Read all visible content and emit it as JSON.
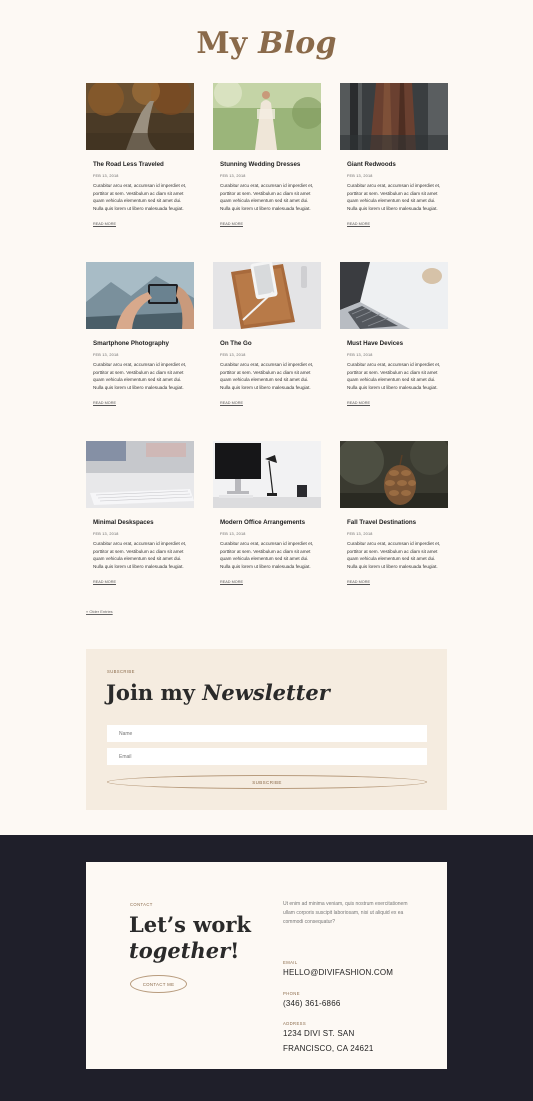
{
  "page": {
    "title_plain": "My",
    "title_italic": "Blog"
  },
  "posts": [
    {
      "title": "The Road Less Traveled",
      "date": "FEB 13, 2018",
      "excerpt": "Curabitur arcu erat, accumsan id imperdiet et, porttitor at sem. Vestibulum ac diam sit amet quam vehicula elementum sed sit amet dui. Nulla quis lorem ut libero malesuada feugiat.",
      "read_more": "READ MORE",
      "image": "forest-road"
    },
    {
      "title": "Stunning Wedding Dresses",
      "date": "FEB 13, 2018",
      "excerpt": "Curabitur arcu erat, accumsan id imperdiet et, porttitor at sem. Vestibulum ac diam sit amet quam vehicula elementum sed sit amet dui. Nulla quis lorem ut libero malesuada feugiat.",
      "read_more": "READ MORE",
      "image": "bride-field"
    },
    {
      "title": "Giant Redwoods",
      "date": "FEB 13, 2018",
      "excerpt": "Curabitur arcu erat, accumsan id imperdiet et, porttitor at sem. Vestibulum ac diam sit amet quam vehicula elementum sed sit amet dui. Nulla quis lorem ut libero malesuada feugiat.",
      "read_more": "READ MORE",
      "image": "redwood-trunk"
    },
    {
      "title": "Smartphone Photography",
      "date": "FEB 13, 2018",
      "excerpt": "Curabitur arcu erat, accumsan id imperdiet et, porttitor at sem. Vestibulum ac diam sit amet quam vehicula elementum sed sit amet dui. Nulla quis lorem ut libero malesuada feugiat.",
      "read_more": "READ MORE",
      "image": "phone-mountains"
    },
    {
      "title": "On The Go",
      "date": "FEB 13, 2018",
      "excerpt": "Curabitur arcu erat, accumsan id imperdiet et, porttitor at sem. Vestibulum ac diam sit amet quam vehicula elementum sed sit amet dui. Nulla quis lorem ut libero malesuada feugiat.",
      "read_more": "READ MORE",
      "image": "phone-leather-case"
    },
    {
      "title": "Must Have Devices",
      "date": "FEB 13, 2018",
      "excerpt": "Curabitur arcu erat, accumsan id imperdiet et, porttitor at sem. Vestibulum ac diam sit amet quam vehicula elementum sed sit amet dui. Nulla quis lorem ut libero malesuada feugiat.",
      "read_more": "READ MORE",
      "image": "laptop-keyboard"
    },
    {
      "title": "Minimal Deskspaces",
      "date": "FEB 13, 2018",
      "excerpt": "Curabitur arcu erat, accumsan id imperdiet et, porttitor at sem. Vestibulum ac diam sit amet quam vehicula elementum sed sit amet dui. Nulla quis lorem ut libero malesuada feugiat.",
      "read_more": "READ MORE",
      "image": "white-keyboard"
    },
    {
      "title": "Modern Office Arrangements",
      "date": "FEB 13, 2018",
      "excerpt": "Curabitur arcu erat, accumsan id imperdiet et, porttitor at sem. Vestibulum ac diam sit amet quam vehicula elementum sed sit amet dui. Nulla quis lorem ut libero malesuada feugiat.",
      "read_more": "READ MORE",
      "image": "desk-monitor-lamp"
    },
    {
      "title": "Fall Travel Destinations",
      "date": "FEB 13, 2018",
      "excerpt": "Curabitur arcu erat, accumsan id imperdiet et, porttitor at sem. Vestibulum ac diam sit amet quam vehicula elementum sed sit amet dui. Nulla quis lorem ut libero malesuada feugiat.",
      "read_more": "READ MORE",
      "image": "pine-cone"
    }
  ],
  "pagination": {
    "older_label": "« Older Entries"
  },
  "newsletter": {
    "eyebrow": "SUBSCRIBE",
    "title_plain": "Join my",
    "title_italic": "Newsletter",
    "name_placeholder": "Name",
    "email_placeholder": "Email",
    "button_label": "SUBSCRIBE"
  },
  "contact": {
    "eyebrow": "CONTACT",
    "title_line1": "Let’s work",
    "title_italic": "together",
    "title_end": "!",
    "button_label": "CONTACT ME",
    "intro": "Ut enim ad minima veniam, quis nostrum exercitationem ullam corporis suscipit laboriosam, nisi ut aliquid ex ea commodi consequatur?",
    "email_label": "EMAIL",
    "email": "HELLO@DIVIFASHION.COM",
    "phone_label": "PHONE",
    "phone": "(346) 361-6866",
    "address_label": "ADDRESS",
    "address_line1": "1234 DIVI ST. SAN",
    "address_line2": "FRANCISCO, CA 24621"
  },
  "colors": {
    "page_bg": "#fdf9f4",
    "accent_brown": "#8a6a4a",
    "newsletter_bg": "#f5ece0",
    "footer_bg": "#1f1f2a"
  }
}
